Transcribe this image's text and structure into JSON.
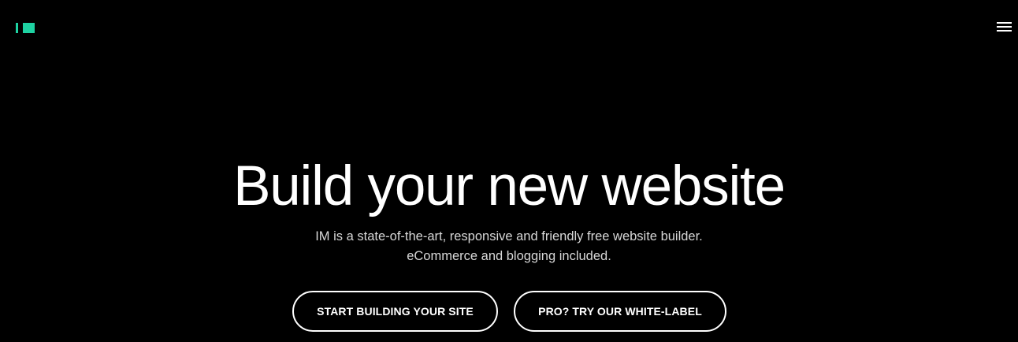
{
  "brand": {
    "logo_text": "IM",
    "accent_color": "#1ed2a2"
  },
  "header": {
    "menu_icon": "hamburger-menu-icon"
  },
  "hero": {
    "title": "Build your new website",
    "subtitle_line1": "IM is a state-of-the-art, responsive and friendly free website builder.",
    "subtitle_line2": "eCommerce and blogging included.",
    "primary_cta": "START BUILDING YOUR SITE",
    "secondary_cta": "PRO? TRY OUR WHITE-LABEL"
  },
  "colors": {
    "background": "#000000",
    "text": "#ffffff",
    "subtitle_text": "#d7d7d7"
  }
}
